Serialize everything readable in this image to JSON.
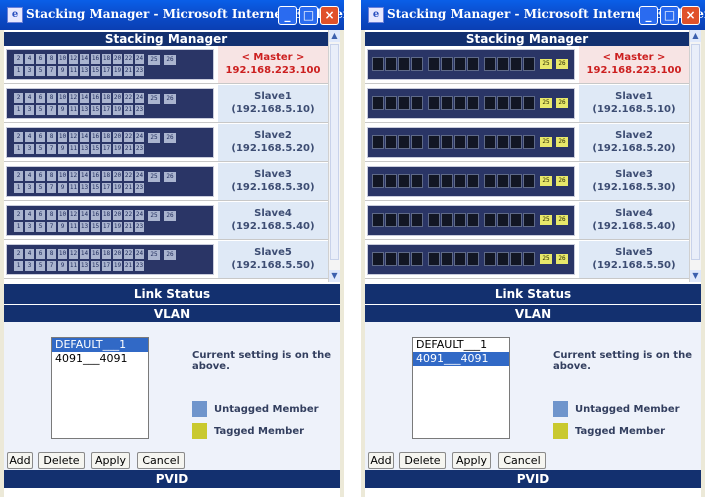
{
  "windows": [
    {
      "title": "Stacking Manager - Microsoft Internet Explorer",
      "panel_title": "Stacking Manager",
      "port_view": "numbered",
      "units": [
        {
          "line1": "< Master >",
          "line2": "192.168.223.100",
          "role": "master"
        },
        {
          "line1": "Slave1",
          "line2": "(192.168.5.10)",
          "role": "slave"
        },
        {
          "line1": "Slave2",
          "line2": "(192.168.5.20)",
          "role": "slave"
        },
        {
          "line1": "Slave3",
          "line2": "(192.168.5.30)",
          "role": "slave"
        },
        {
          "line1": "Slave4",
          "line2": "(192.168.5.40)",
          "role": "slave"
        },
        {
          "line1": "Slave5",
          "line2": "(192.168.5.50)",
          "role": "slave"
        }
      ],
      "link_status": "Link Status",
      "vlan": "VLAN",
      "vlan_list": [
        {
          "label": "DEFAULT___1",
          "selected": true
        },
        {
          "label": "4091___4091",
          "selected": false
        }
      ],
      "current_note": "Current setting is on the above.",
      "legend": {
        "untagged": "Untagged Member",
        "tagged": "Tagged Member"
      },
      "buttons": {
        "add": "Add",
        "delete": "Delete",
        "apply": "Apply",
        "cancel": "Cancel"
      },
      "pvid": "PVID"
    },
    {
      "title": "Stacking Manager - Microsoft Internet Explorer",
      "panel_title": "Stacking Manager",
      "port_view": "rj45",
      "units": [
        {
          "line1": "< Master >",
          "line2": "192.168.223.100",
          "role": "master"
        },
        {
          "line1": "Slave1",
          "line2": "(192.168.5.10)",
          "role": "slave"
        },
        {
          "line1": "Slave2",
          "line2": "(192.168.5.20)",
          "role": "slave"
        },
        {
          "line1": "Slave3",
          "line2": "(192.168.5.30)",
          "role": "slave"
        },
        {
          "line1": "Slave4",
          "line2": "(192.168.5.40)",
          "role": "slave"
        },
        {
          "line1": "Slave5",
          "line2": "(192.168.5.50)",
          "role": "slave"
        }
      ],
      "link_status": "Link Status",
      "vlan": "VLAN",
      "vlan_list": [
        {
          "label": "DEFAULT___1",
          "selected": false
        },
        {
          "label": "4091___4091",
          "selected": true
        }
      ],
      "current_note": "Current setting is on the above.",
      "legend": {
        "untagged": "Untagged Member",
        "tagged": "Tagged Member"
      },
      "buttons": {
        "add": "Add",
        "delete": "Delete",
        "apply": "Apply",
        "cancel": "Cancel"
      },
      "pvid": "PVID"
    }
  ],
  "port_labels": {
    "top": [
      "2",
      "4",
      "6",
      "8",
      "10",
      "12",
      "14",
      "16",
      "18",
      "20",
      "22",
      "24"
    ],
    "bottom": [
      "1",
      "3",
      "5",
      "7",
      "9",
      "11",
      "13",
      "15",
      "17",
      "19",
      "21",
      "23"
    ],
    "uplinks": [
      "25",
      "26"
    ]
  },
  "icons": {
    "app": "ie-icon",
    "minimize": "minimize-icon",
    "maximize": "maximize-icon",
    "close": "close-icon"
  },
  "colors": {
    "header_bg": "#13306f",
    "master_text": "#cc1f1f",
    "untagged": "#6f95cc",
    "tagged": "#c9c92e",
    "selection": "#3169c6"
  }
}
